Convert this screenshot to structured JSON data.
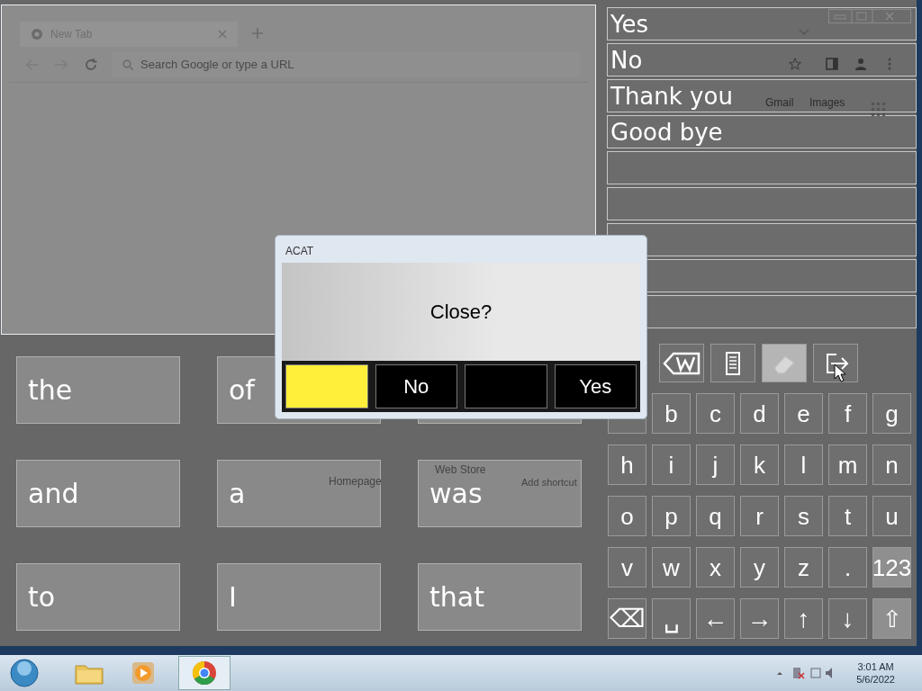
{
  "browser": {
    "tab": {
      "title": "New Tab"
    },
    "omnibox": {
      "placeholder": "Search Google or type a URL"
    },
    "header_links": [
      "Gmail",
      "Images"
    ],
    "shortcuts": [
      "Homepage",
      "Web Store",
      "Add shortcut"
    ]
  },
  "phrases": [
    "Yes",
    "No",
    "Thank you",
    "Good bye"
  ],
  "toolbar": [
    {
      "kind": "delete-word",
      "selected": false
    },
    {
      "kind": "notes",
      "selected": false
    },
    {
      "kind": "eraser",
      "selected": true
    },
    {
      "kind": "exit",
      "selected": false
    }
  ],
  "keyboard": [
    [
      {
        "kind": "letter"
      },
      {
        "label": "b",
        "kind": "letter"
      },
      {
        "label": "c",
        "kind": "letter"
      },
      {
        "label": "d",
        "kind": "letter"
      },
      {
        "label": "e",
        "kind": "letter"
      },
      {
        "label": "f",
        "kind": "letter"
      },
      {
        "label": "g",
        "kind": "letter"
      }
    ],
    [
      {
        "label": "h",
        "kind": "letter"
      },
      {
        "label": "i",
        "kind": "letter"
      },
      {
        "label": "j",
        "kind": "letter"
      },
      {
        "label": "k",
        "kind": "letter"
      },
      {
        "label": "l",
        "kind": "letter"
      },
      {
        "label": "m",
        "kind": "letter"
      },
      {
        "label": "n",
        "kind": "letter"
      }
    ],
    [
      {
        "label": "o",
        "kind": "letter"
      },
      {
        "label": "p",
        "kind": "letter"
      },
      {
        "label": "q",
        "kind": "letter"
      },
      {
        "label": "r",
        "kind": "letter"
      },
      {
        "label": "s",
        "kind": "letter"
      },
      {
        "label": "t",
        "kind": "letter"
      },
      {
        "label": "u",
        "kind": "letter"
      }
    ],
    [
      {
        "label": "v",
        "kind": "letter"
      },
      {
        "label": "w",
        "kind": "letter"
      },
      {
        "label": "x",
        "kind": "letter"
      },
      {
        "label": "y",
        "kind": "letter"
      },
      {
        "label": "z",
        "kind": "letter"
      },
      {
        "label": ".",
        "kind": "letter"
      },
      {
        "label": "123",
        "kind": "mode"
      }
    ],
    [
      {
        "label": "⌫",
        "kind": "action"
      },
      {
        "label": "␣",
        "kind": "action"
      },
      {
        "label": "←",
        "kind": "action"
      },
      {
        "label": "→",
        "kind": "action"
      },
      {
        "label": "↑",
        "kind": "action"
      },
      {
        "label": "↓",
        "kind": "action"
      },
      {
        "label": "⇧",
        "kind": "mode"
      }
    ]
  ],
  "word_predictions": [
    [
      "the",
      "of"
    ],
    [
      "and",
      "a",
      "was"
    ],
    [
      "to",
      "I",
      "that"
    ]
  ],
  "dialog": {
    "title": "ACAT",
    "message": "Close?",
    "buttons": [
      {
        "selected": true
      },
      {
        "label": "No",
        "selected": false
      },
      {
        "selected": false
      },
      {
        "label": "Yes",
        "selected": false
      }
    ]
  },
  "taskbar": {
    "time": "3:01 AM",
    "date": "5/6/2022"
  }
}
